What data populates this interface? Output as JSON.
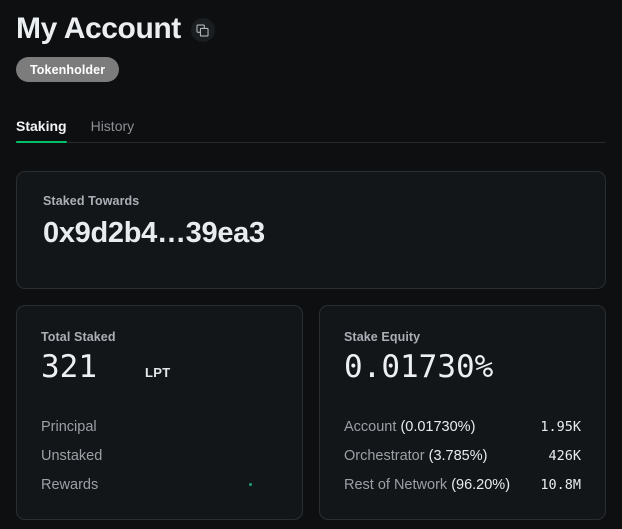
{
  "header": {
    "title": "My Account",
    "copy_icon": "copy-icon",
    "badge": "Tokenholder"
  },
  "tabs": [
    {
      "label": "Staking",
      "active": true
    },
    {
      "label": "History",
      "active": false
    }
  ],
  "staked_towards_card": {
    "label": "Staked Towards",
    "address": "0x9d2b4…39ea3"
  },
  "total_staked_card": {
    "label": "Total Staked",
    "value": "321",
    "unit": "LPT",
    "rows": [
      {
        "label": "Principal",
        "value": ""
      },
      {
        "label": "Unstaked",
        "value": ""
      },
      {
        "label": "Rewards",
        "value": ""
      }
    ]
  },
  "stake_equity_card": {
    "label": "Stake Equity",
    "value": "0.01730%",
    "rows": [
      {
        "name": "Account",
        "pct": "(0.01730%)",
        "value": "1.95K"
      },
      {
        "name": "Orchestrator",
        "pct": "(3.785%)",
        "value": "426K"
      },
      {
        "name": "Rest of Network",
        "pct": "(96.20%)",
        "value": "10.8M"
      }
    ]
  },
  "colors": {
    "background": "#0e0f10",
    "card_background": "#131619",
    "card_border": "#2a2e32",
    "accent_green": "#00c16a",
    "badge_gray": "#7c7c7c",
    "text_primary": "#e9ecee",
    "text_muted": "#9aa0a6"
  }
}
